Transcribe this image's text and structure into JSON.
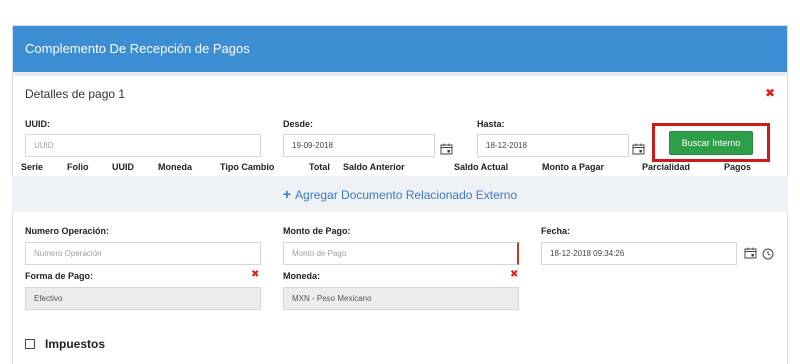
{
  "header": {
    "title": "Complemento De Recepción de Pagos"
  },
  "detalles": {
    "title": "Detalles de pago 1"
  },
  "uuid": {
    "label": "UUID:",
    "placeholder": "UUID"
  },
  "desde": {
    "label": "Desde:",
    "value": "19-09-2018"
  },
  "hasta": {
    "label": "Hasta:",
    "value": "18-12-2018"
  },
  "buscar_button": "Buscar Interno",
  "table": {
    "columns": [
      "Serie",
      "Folio",
      "UUID",
      "Moneda",
      "Tipo Cambio",
      "Total",
      "Saldo Anterior",
      "Saldo Actual",
      "Monto a Pagar",
      "Parcialidad",
      "Pagos"
    ]
  },
  "add_external": {
    "label": "Agregar Documento Relacionado Externo"
  },
  "numero_operacion": {
    "label": "Numero Operación:",
    "placeholder": "Numero Operación"
  },
  "monto_pago": {
    "label": "Monto de Pago:",
    "placeholder": "Monto de Pago"
  },
  "fecha": {
    "label": "Fecha:",
    "value": "18-12-2018 09:34:26"
  },
  "forma_pago": {
    "label": "Forma de Pago:",
    "value": "Efectivo"
  },
  "moneda": {
    "label": "Moneda:",
    "value": "MXN - Peso Mexicano"
  },
  "impuestos": {
    "label": "Impuestos"
  },
  "colors": {
    "header_bg": "#3c8dd1",
    "button_green": "#2f9e4b",
    "highlight_red": "#cc1b1b",
    "link_blue": "#3b78c2"
  }
}
